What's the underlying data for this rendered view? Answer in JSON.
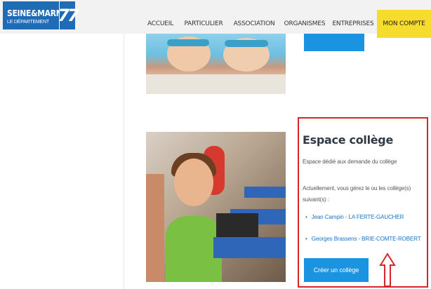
{
  "header": {
    "logo": {
      "title": "SEINE&MARNE",
      "subtitle": "LE DÉPARTEMENT",
      "number": "77"
    },
    "nav": [
      {
        "label": "ACCUEIL"
      },
      {
        "label": "PARTICULIER"
      },
      {
        "label": "ASSOCIATION"
      },
      {
        "label": "ORGANISMES"
      },
      {
        "label": "ENTREPRISES"
      },
      {
        "label": "MON COMPTE"
      }
    ]
  },
  "card": {
    "title": "Espace collège",
    "description": "Espace dédié aux demande du collège",
    "intro": "Actuellement, vous gérez le ou les collège(s) suivant(s) :",
    "colleges": [
      {
        "label": "Jean Campin - LA FERTE-GAUCHER"
      },
      {
        "label": "Georges Brassens - BRIE-COMTE-ROBERT"
      }
    ],
    "create_button": "Créer un collège"
  },
  "colors": {
    "brand_blue": "#1f6bb6",
    "button_blue": "#1a93e0",
    "nav_accent": "#f6dc2c",
    "highlight_red": "#d9252a"
  },
  "icons": [
    "arrow-up-icon"
  ]
}
